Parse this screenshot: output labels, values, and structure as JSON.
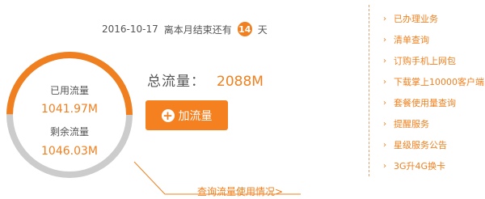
{
  "header": {
    "date": "2016-10-17",
    "month_end_text": "离本月结束还有",
    "days_left": "14",
    "days_unit": "天"
  },
  "usage": {
    "used_label": "已用流量",
    "used_value": "1041.97M",
    "remaining_label": "剩余流量",
    "remaining_value": "1046.03M",
    "used_fraction": 0.4983
  },
  "total": {
    "label": "总流量：",
    "value": "2088M"
  },
  "add_button": {
    "icon": "plus-icon",
    "label": "加流量"
  },
  "query_link": "查询流量使用情况>",
  "side_menu": {
    "arrow_icon": "chevron-right-icon",
    "items": [
      "已办理业务",
      "清单查询",
      "订购手机上网包",
      "下载掌上10000客户端",
      "套餐使用量查询",
      "提醒服务",
      "星级服务公告",
      "3G升4G换卡"
    ]
  },
  "colors": {
    "accent": "#f0801f",
    "ring_track": "#cccccc",
    "text": "#555555"
  }
}
